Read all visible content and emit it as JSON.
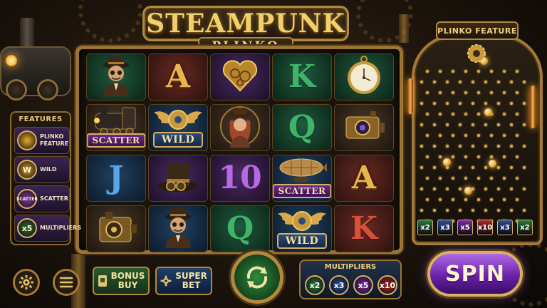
{
  "title": {
    "main": "STEAMPUNK",
    "sub": "PLINKO"
  },
  "grid": [
    [
      {
        "kind": "portrait-man",
        "bg": "c-grn"
      },
      {
        "kind": "letter",
        "text": "A",
        "color": "l-gold",
        "bg": "c-red"
      },
      {
        "kind": "heart-gear",
        "bg": "c-pur"
      },
      {
        "kind": "letter",
        "text": "K",
        "color": "l-grn",
        "bg": "c-grn"
      },
      {
        "kind": "pocket-watch",
        "bg": "c-grn"
      }
    ],
    [
      {
        "kind": "train",
        "bg": "c-brn",
        "badge": "SCATTER",
        "badge_type": "b-scatter"
      },
      {
        "kind": "winged-gear",
        "bg": "c-blu",
        "badge": "WILD",
        "badge_type": "b-wild"
      },
      {
        "kind": "portrait-woman",
        "bg": "c-brn"
      },
      {
        "kind": "letter",
        "text": "Q",
        "color": "l-grn",
        "bg": "c-grn"
      },
      {
        "kind": "camera-device",
        "bg": "c-brn"
      }
    ],
    [
      {
        "kind": "letter",
        "text": "J",
        "color": "l-blu",
        "bg": "c-blu"
      },
      {
        "kind": "top-hat",
        "bg": "c-pur"
      },
      {
        "kind": "letter",
        "text": "10",
        "color": "l-pur",
        "bg": "c-pur"
      },
      {
        "kind": "airship",
        "bg": "c-blu",
        "badge": "SCATTER",
        "badge_type": "b-scatter"
      },
      {
        "kind": "letter",
        "text": "A",
        "color": "l-gold",
        "bg": "c-red"
      }
    ],
    [
      {
        "kind": "engine-box",
        "bg": "c-brn"
      },
      {
        "kind": "portrait-man",
        "bg": "c-blu"
      },
      {
        "kind": "letter",
        "text": "Q",
        "color": "l-grn",
        "bg": "c-grn"
      },
      {
        "kind": "winged-gear",
        "bg": "c-blu",
        "badge": "WILD",
        "badge_type": "b-wild"
      },
      {
        "kind": "letter",
        "text": "K",
        "color": "l-red",
        "bg": "c-red"
      }
    ]
  ],
  "features": {
    "title": "FEATURES",
    "items": [
      {
        "label": "PLINKO FEATURE",
        "icon": "plinko-ball-icon",
        "glyph": "",
        "color": "#e6a932"
      },
      {
        "label": "WILD",
        "icon": "wild-w-icon",
        "glyph": "W",
        "color": "#c99a3a"
      },
      {
        "label": "SCATTER",
        "icon": "scatter-icon",
        "glyph": "SCATTER",
        "color": "#7a3aa8"
      },
      {
        "label": "MULTIPLIERS",
        "icon": "multiplier-icon",
        "glyph": "x5",
        "color": "#2a6a3a"
      }
    ]
  },
  "controls": {
    "bonus_buy": "BONUS BUY",
    "super_bet": "SUPER BET",
    "spin": "SPIN"
  },
  "multipliers_panel": {
    "title": "MULTIPLIERS",
    "values": [
      {
        "label": "x2",
        "color": "#2a7a3a"
      },
      {
        "label": "x3",
        "color": "#2a4e8a"
      },
      {
        "label": "x5",
        "color": "#7a2aa8"
      },
      {
        "label": "x10",
        "color": "#a82a2a"
      }
    ]
  },
  "plinko": {
    "title": "PLINKO FEATURE",
    "slots": [
      {
        "label": "x2",
        "color": "#2a7a3a"
      },
      {
        "label": "x3",
        "color": "#2a4e8a"
      },
      {
        "label": "x5",
        "color": "#7a2aa8"
      },
      {
        "label": "x10",
        "color": "#a82a2a"
      },
      {
        "label": "x3",
        "color": "#2a4e8a"
      },
      {
        "label": "x2",
        "color": "#2a7a3a"
      }
    ]
  }
}
